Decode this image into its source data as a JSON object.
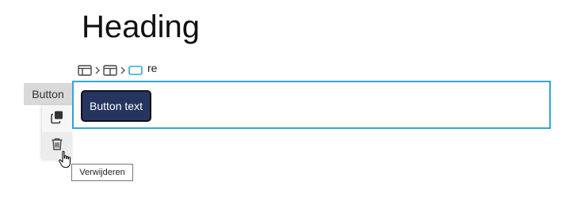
{
  "page": {
    "heading": "Heading",
    "behind_text_fragment": "re"
  },
  "breadcrumb": {
    "items": [
      {
        "icon": "section-layout-icon"
      },
      {
        "icon": "column-layout-icon"
      },
      {
        "icon": "block-icon"
      }
    ],
    "separator_icon": "chevron-right-icon"
  },
  "component": {
    "type_label": "Button",
    "button_text": "Button text"
  },
  "toolbar": {
    "duplicate_icon": "duplicate-icon",
    "delete_icon": "trash-icon"
  },
  "tooltip": {
    "text": "Verwijderen"
  },
  "colors": {
    "selection_border": "#2ea8d8",
    "button_bg": "#26355f",
    "label_bg": "#d9d9d9",
    "toolbar_bg": "#f6f6f6"
  }
}
